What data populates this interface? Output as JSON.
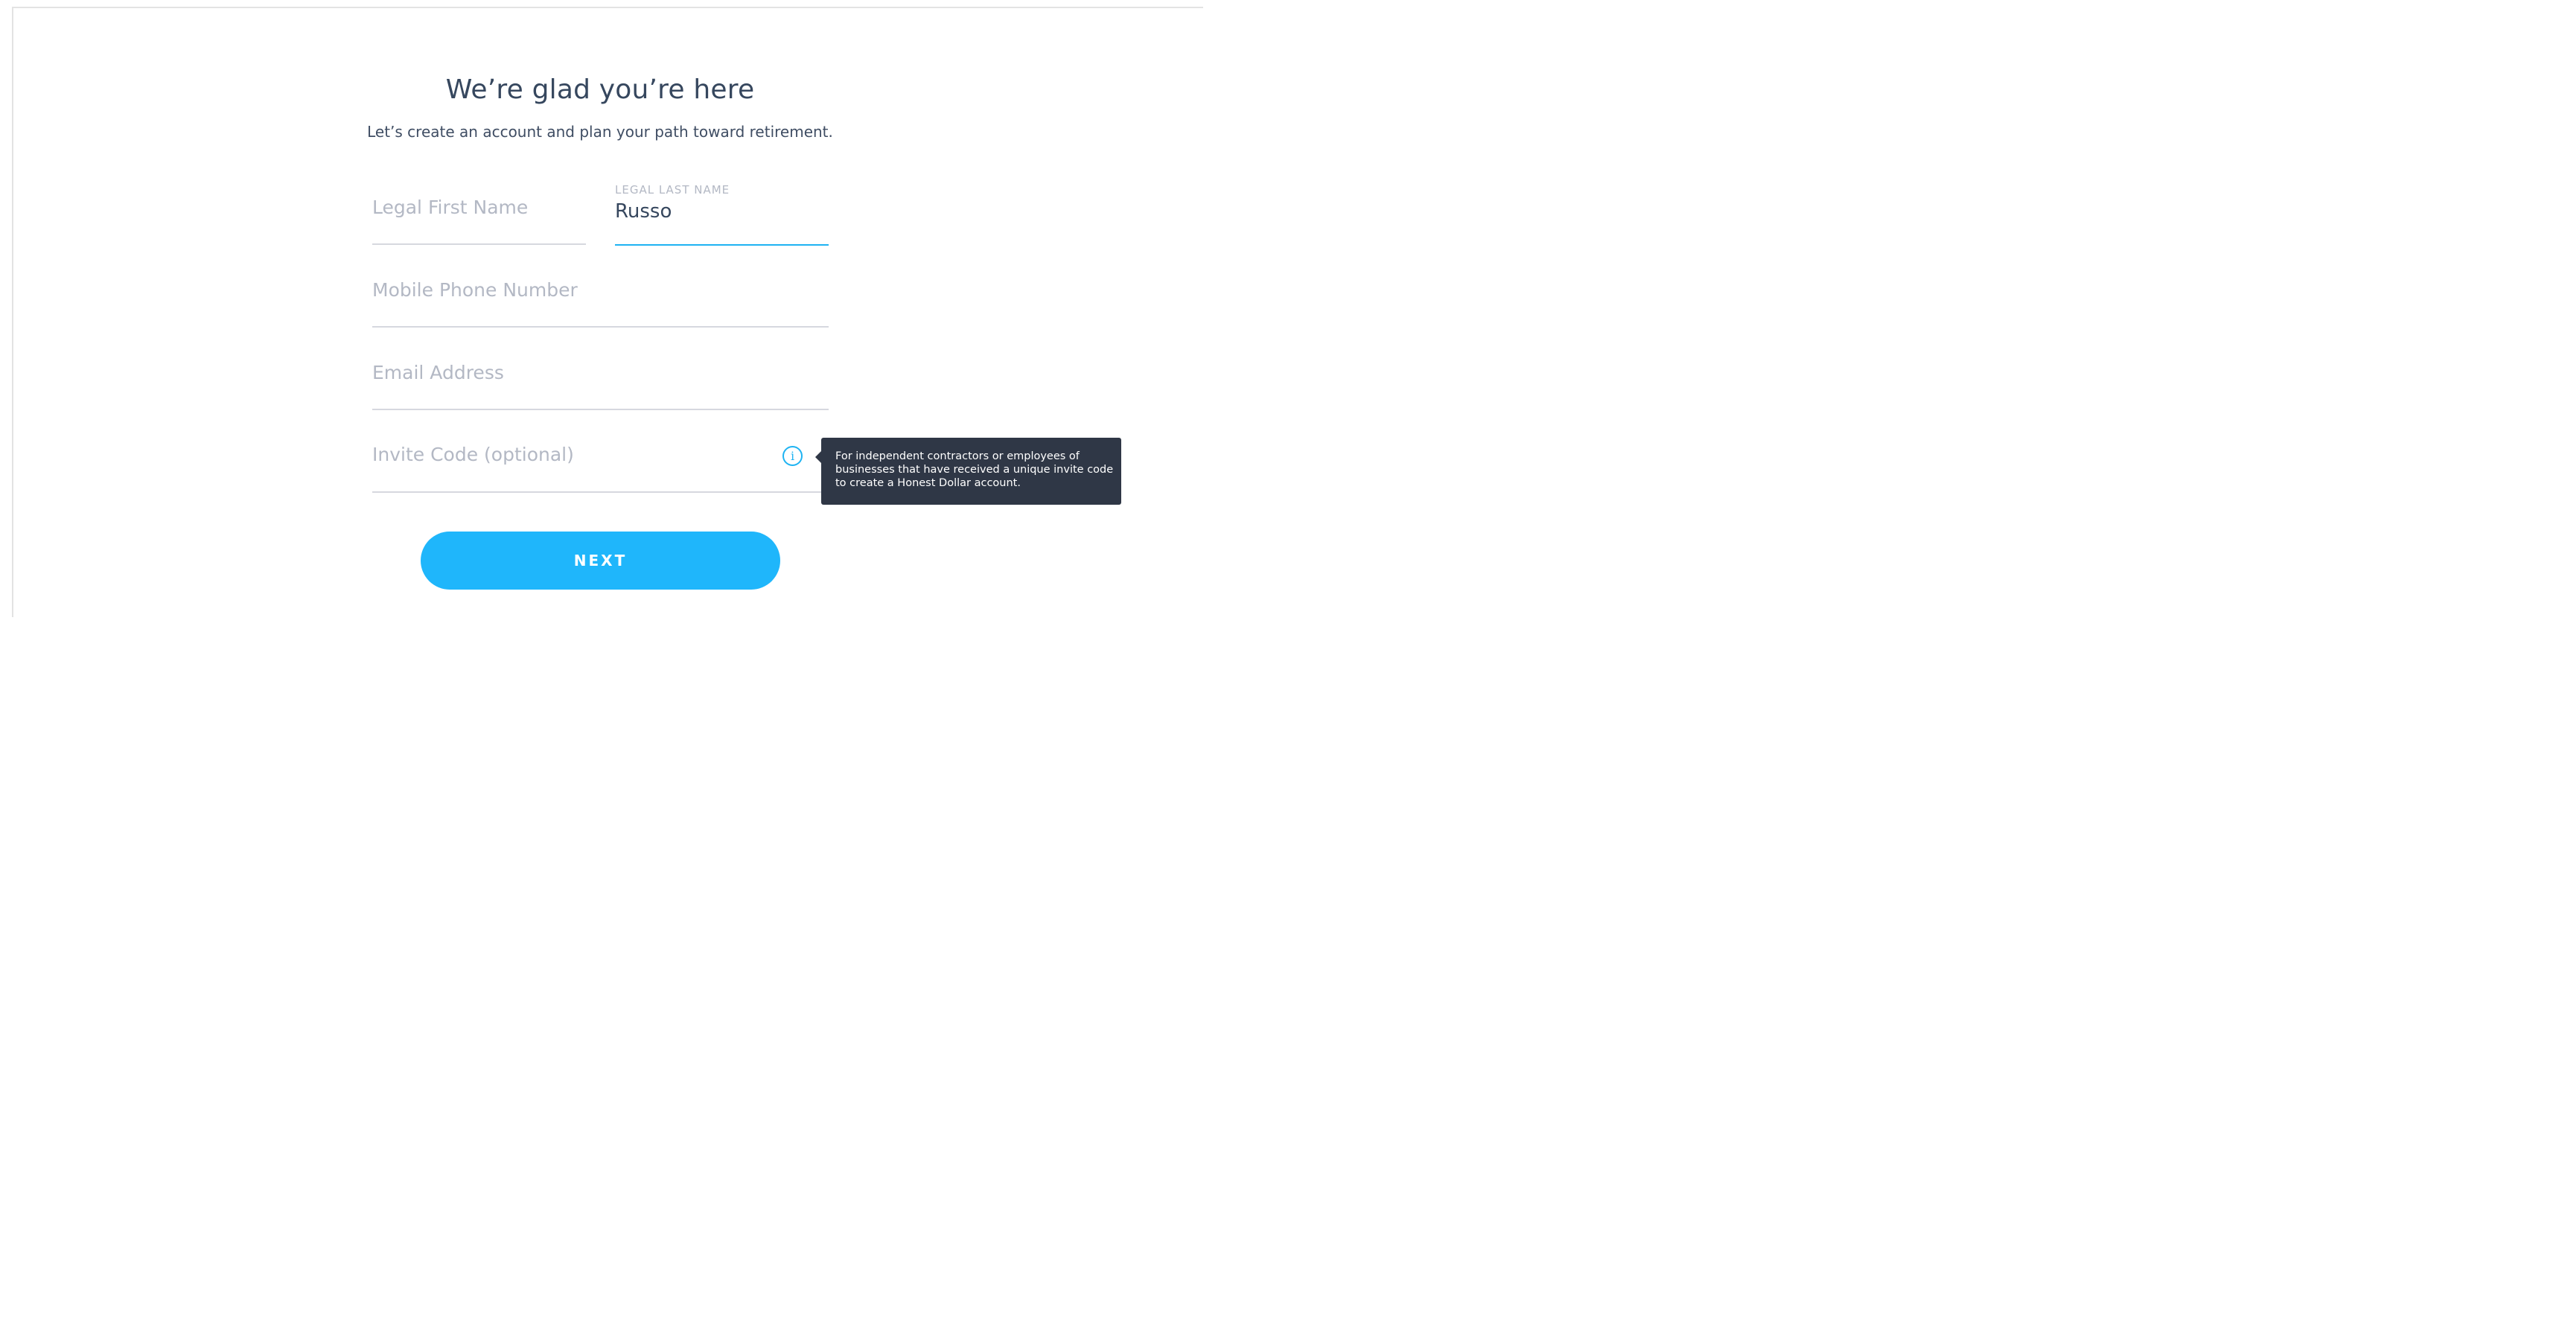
{
  "header": {
    "title": "We’re glad you’re here",
    "subtitle": "Let’s create an account and plan your path toward retirement."
  },
  "form": {
    "first_name": {
      "placeholder": "Legal First Name",
      "value": ""
    },
    "last_name": {
      "label": "LEGAL LAST NAME",
      "value": "Russo"
    },
    "phone": {
      "placeholder": "Mobile Phone Number",
      "value": ""
    },
    "email": {
      "placeholder": "Email Address",
      "value": ""
    },
    "invite_code": {
      "placeholder": "Invite Code (optional)",
      "value": "",
      "info_icon": "info-icon",
      "info_glyph": "i"
    },
    "next_label": "NEXT"
  },
  "tooltip": {
    "lines": [
      "For independent contractors or employees of",
      "businesses that have received a unique invite code",
      "to create a Honest Dollar account."
    ]
  },
  "colors": {
    "accent": "#1fb6fb",
    "heading": "#36475e",
    "placeholder": "#b3b8c4",
    "underline": "#d6d8df",
    "tooltip_bg": "#2f3746"
  }
}
